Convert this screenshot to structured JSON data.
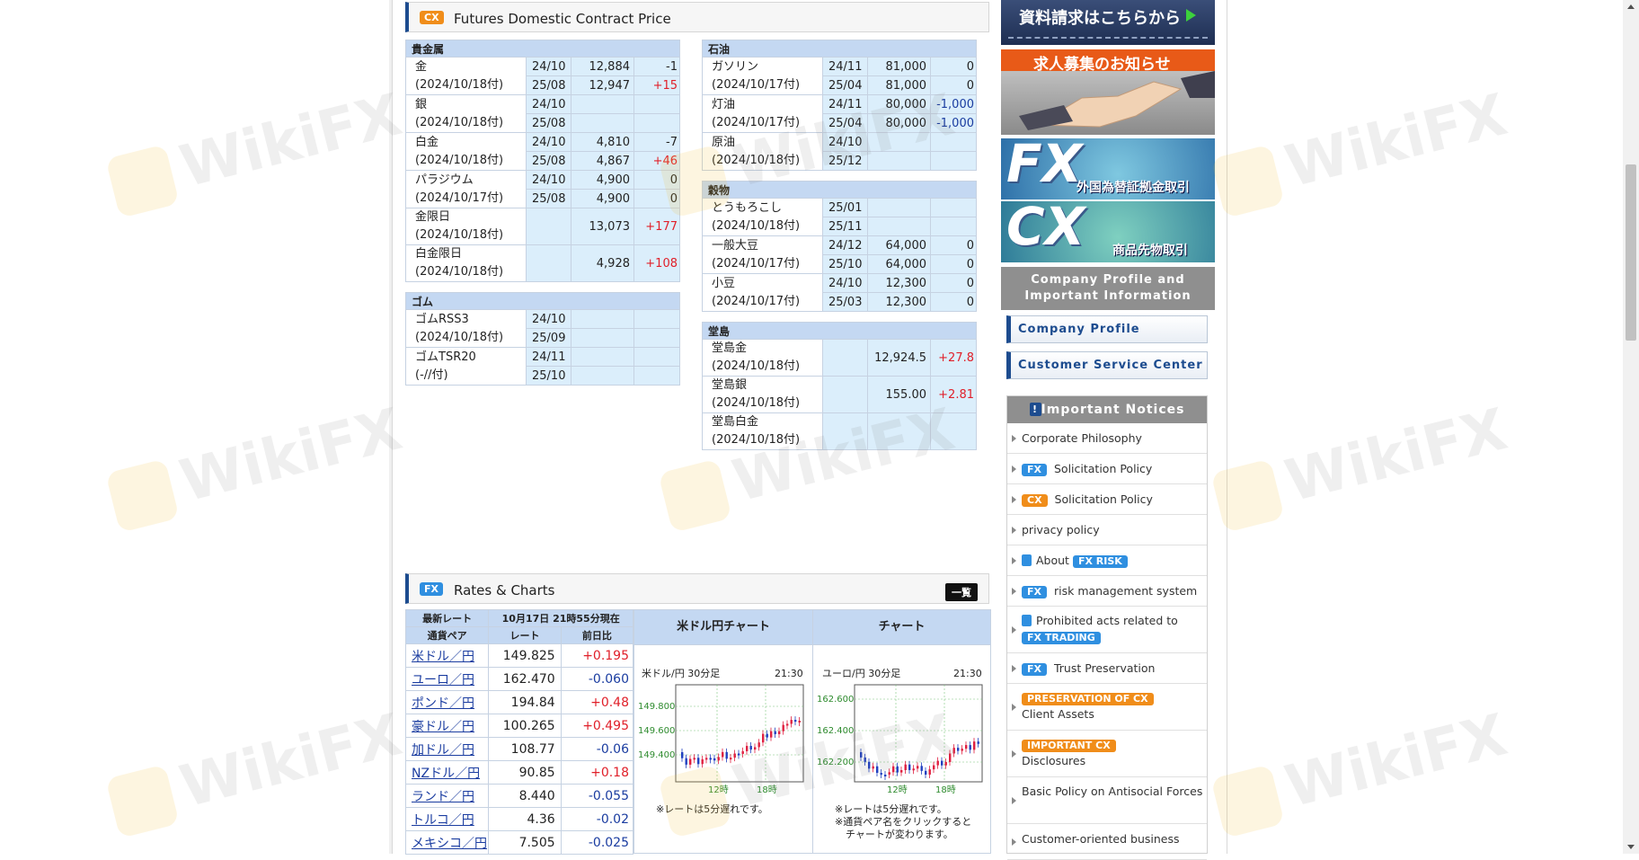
{
  "watermark": "WikiFX",
  "futures": {
    "badge": "CX",
    "title": "Futures Domestic Contract Price",
    "left": [
      {
        "category": "貴金属",
        "items": [
          {
            "name": "金",
            "date": "(2024/10/18付)",
            "rows": [
              {
                "month": "24/10",
                "price": "12,884",
                "change": "-1",
                "dir": "neg0"
              },
              {
                "month": "25/08",
                "price": "12,947",
                "change": "+15",
                "dir": "pos"
              }
            ]
          },
          {
            "name": "銀",
            "date": "(2024/10/18付)",
            "rows": [
              {
                "month": "24/10",
                "price": "",
                "change": "",
                "dir": ""
              },
              {
                "month": "25/08",
                "price": "",
                "change": "",
                "dir": ""
              }
            ]
          },
          {
            "name": "白金",
            "date": "(2024/10/18付)",
            "rows": [
              {
                "month": "24/10",
                "price": "4,810",
                "change": "-7",
                "dir": "neg0"
              },
              {
                "month": "25/08",
                "price": "4,867",
                "change": "+46",
                "dir": "pos"
              }
            ]
          },
          {
            "name": "パラジウム",
            "date": "(2024/10/17付)",
            "rows": [
              {
                "month": "24/10",
                "price": "4,900",
                "change": "0",
                "dir": ""
              },
              {
                "month": "25/08",
                "price": "4,900",
                "change": "0",
                "dir": ""
              }
            ]
          },
          {
            "name": "金限日",
            "date": "(2024/10/18付)",
            "single": true,
            "rows": [
              {
                "month": "",
                "price": "13,073",
                "change": "+177",
                "dir": "pos"
              }
            ]
          },
          {
            "name": "白金限日",
            "date": "(2024/10/18付)",
            "single": true,
            "rows": [
              {
                "month": "",
                "price": "4,928",
                "change": "+108",
                "dir": "pos"
              }
            ]
          }
        ]
      },
      {
        "category": "ゴム",
        "items": [
          {
            "name": "ゴムRSS3",
            "date": "(2024/10/18付)",
            "rows": [
              {
                "month": "24/10",
                "price": "",
                "change": "",
                "dir": ""
              },
              {
                "month": "25/09",
                "price": "",
                "change": "",
                "dir": ""
              }
            ]
          },
          {
            "name": "ゴムTSR20",
            "date": "(-//付)",
            "rows": [
              {
                "month": "24/11",
                "price": "",
                "change": "",
                "dir": ""
              },
              {
                "month": "25/10",
                "price": "",
                "change": "",
                "dir": ""
              }
            ]
          }
        ]
      }
    ],
    "right": [
      {
        "category": "石油",
        "items": [
          {
            "name": "ガソリン",
            "date": "(2024/10/17付)",
            "rows": [
              {
                "month": "24/11",
                "price": "81,000",
                "change": "0",
                "dir": ""
              },
              {
                "month": "25/04",
                "price": "81,000",
                "change": "0",
                "dir": ""
              }
            ]
          },
          {
            "name": "灯油",
            "date": "(2024/10/17付)",
            "rows": [
              {
                "month": "24/11",
                "price": "80,000",
                "change": "-1,000",
                "dir": "neg"
              },
              {
                "month": "25/04",
                "price": "80,000",
                "change": "-1,000",
                "dir": "neg"
              }
            ]
          },
          {
            "name": "原油",
            "date": "(2024/10/18付)",
            "rows": [
              {
                "month": "24/10",
                "price": "",
                "change": "",
                "dir": ""
              },
              {
                "month": "25/12",
                "price": "",
                "change": "",
                "dir": ""
              }
            ]
          }
        ]
      },
      {
        "category": "穀物",
        "items": [
          {
            "name": "とうもろこし",
            "date": "(2024/10/18付)",
            "rows": [
              {
                "month": "25/01",
                "price": "",
                "change": "",
                "dir": ""
              },
              {
                "month": "25/11",
                "price": "",
                "change": "",
                "dir": ""
              }
            ]
          },
          {
            "name": "一般大豆",
            "date": "(2024/10/17付)",
            "rows": [
              {
                "month": "24/12",
                "price": "64,000",
                "change": "0",
                "dir": ""
              },
              {
                "month": "25/10",
                "price": "64,000",
                "change": "0",
                "dir": ""
              }
            ]
          },
          {
            "name": "小豆",
            "date": "(2024/10/17付)",
            "rows": [
              {
                "month": "24/10",
                "price": "12,300",
                "change": "0",
                "dir": ""
              },
              {
                "month": "25/03",
                "price": "12,300",
                "change": "0",
                "dir": ""
              }
            ]
          }
        ]
      },
      {
        "category": "堂島",
        "items": [
          {
            "name": "堂島金",
            "date": "(2024/10/18付)",
            "single": true,
            "rows": [
              {
                "month": "",
                "price": "12,924.5",
                "change": "+27.8",
                "dir": "pos"
              }
            ]
          },
          {
            "name": "堂島銀",
            "date": "(2024/10/18付)",
            "single": true,
            "rows": [
              {
                "month": "",
                "price": "155.00",
                "change": "+2.81",
                "dir": "pos"
              }
            ]
          },
          {
            "name": "堂島白金",
            "date": "(2024/10/18付)",
            "single": true,
            "rows": [
              {
                "month": "",
                "price": "",
                "change": "",
                "dir": ""
              }
            ]
          }
        ]
      }
    ]
  },
  "rates": {
    "badge": "FX",
    "title": "Rates & Charts",
    "all_button": "一覧",
    "header_left": "最新レート",
    "header_time": "10月17日 21時55分現在",
    "col_pair": "通貨ペア",
    "col_rate": "レート",
    "col_change": "前日比",
    "rows": [
      {
        "pair": "米ドル／円",
        "rate": "149.825",
        "change": "+0.195",
        "dir": "pos"
      },
      {
        "pair": "ユーロ／円",
        "rate": "162.470",
        "change": "-0.060",
        "dir": "neg"
      },
      {
        "pair": "ポンド／円",
        "rate": "194.84",
        "change": "+0.48",
        "dir": "pos"
      },
      {
        "pair": "豪ドル／円",
        "rate": "100.265",
        "change": "+0.495",
        "dir": "pos"
      },
      {
        "pair": "加ドル／円",
        "rate": "108.77",
        "change": "-0.06",
        "dir": "neg"
      },
      {
        "pair": "NZドル／円",
        "rate": "90.85",
        "change": "+0.18",
        "dir": "pos"
      },
      {
        "pair": "ランド／円",
        "rate": "8.440",
        "change": "-0.055",
        "dir": "neg"
      },
      {
        "pair": "トルコ／円",
        "rate": "4.36",
        "change": "-0.02",
        "dir": "neg"
      },
      {
        "pair": "メキシコ／円",
        "rate": "7.505",
        "change": "-0.025",
        "dir": "neg"
      }
    ],
    "chart1": {
      "header": "米ドル円チャート",
      "label": "米ドル/円 30分足",
      "time": "21:30",
      "yticks": [
        "149.800",
        "149.600",
        "149.400"
      ],
      "xticks": [
        "12時",
        "18時"
      ],
      "note": "※レートは5分遅れです。"
    },
    "chart2": {
      "header": "チャート",
      "label": "ユーロ/円 30分足",
      "time": "21:30",
      "yticks": [
        "162.600",
        "162.400",
        "162.200"
      ],
      "xticks": [
        "12時",
        "18時"
      ],
      "note1": "※レートは5分遅れです。",
      "note2": "※通貨ペア名をクリックすると",
      "note3": "チャートが変わります。"
    }
  },
  "sidebar": {
    "banner1": "資料請求はこちらから",
    "banner2": "求人募集のお知らせ",
    "banner3_big": "FX",
    "banner3_small": "外国為替証拠金取引",
    "banner4_big": "CX",
    "banner4_small": "商品先物取引",
    "info_head_1": "Company Profile and",
    "info_head_2": "Important Information",
    "btn_profile": "Company Profile",
    "btn_service": "Customer Service Center",
    "notices_title": "Important Notices",
    "notices": {
      "philosophy": "Corporate Philosophy",
      "fx_tag": "FX",
      "cx_tag": "CX",
      "solicitation": "Solicitation Policy",
      "privacy": "privacy policy",
      "about": "About",
      "fx_risk": "FX RISK",
      "risk_mgmt": "risk management system",
      "prohibited": "Prohibited acts related to",
      "fx_trading": "FX TRADING",
      "trust": "Trust Preservation",
      "preservation_tag": "PRESERVATION OF CX",
      "client_assets": "Client Assets",
      "important_tag": "IMPORTANT CX",
      "disclosures": "Disclosures",
      "antisocial": "Basic Policy on Antisocial Forces",
      "customer_oriented": "Customer-oriented business"
    }
  }
}
